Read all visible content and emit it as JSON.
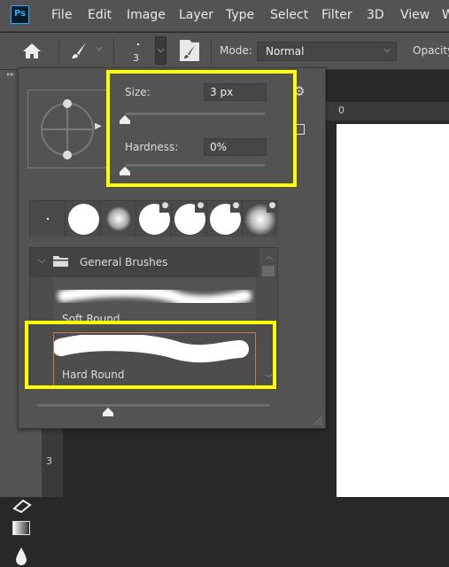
{
  "app": {
    "logo": "Ps"
  },
  "menu": [
    "File",
    "Edit",
    "Image",
    "Layer",
    "Type",
    "Select",
    "Filter",
    "3D",
    "View",
    "W"
  ],
  "options_bar": {
    "brush_size_value": "3",
    "mode_label": "Mode:",
    "mode_value": "Normal",
    "opacity_label": "Opacity"
  },
  "brush_panel": {
    "size_label": "Size:",
    "size_value": "3 px",
    "size_slider": 0.0,
    "hardness_label": "Hardness:",
    "hardness_value": "0%",
    "hardness_slider": 0.0,
    "tips": [
      "dot",
      "hard",
      "soft",
      "hard-pressure",
      "hard-pressure",
      "hard-pressure",
      "soft-pressure"
    ],
    "group_name": "General Brushes",
    "presets": [
      {
        "name": "Soft Round",
        "selected": false
      },
      {
        "name": "Hard Round",
        "selected": true
      }
    ],
    "preview_size_slider": 0.3
  },
  "ruler": {
    "h_zero": "0",
    "v_label": "3"
  },
  "colors": {
    "highlight": "#ffff00",
    "selection_border": "#c8784a",
    "ps_accent": "#31a8ff"
  }
}
